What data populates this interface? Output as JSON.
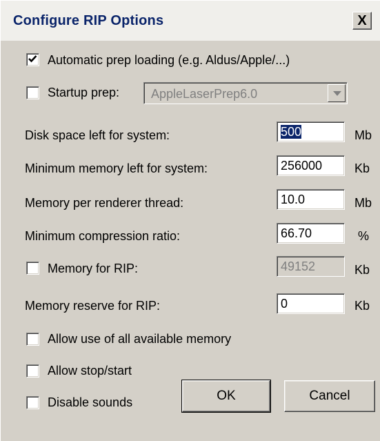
{
  "window": {
    "title": "Configure RIP Options",
    "close_label": "X"
  },
  "options": {
    "auto_prep": {
      "label": "Automatic prep loading (e.g. Aldus/Apple/...)",
      "checked": true
    },
    "startup_prep": {
      "label": "Startup prep:",
      "checked": false,
      "value": "AppleLaserPrep6.0",
      "enabled": false
    }
  },
  "fields": {
    "disk_space": {
      "label": "Disk space left for system:",
      "value": "500",
      "unit": "Mb"
    },
    "min_memory": {
      "label": "Minimum memory left for system:",
      "value": "256000",
      "unit": "Kb"
    },
    "memory_per_thread": {
      "label": "Memory per renderer thread:",
      "value": "10.0",
      "unit": "Mb"
    },
    "min_compression": {
      "label": "Minimum compression ratio:",
      "value": "66.70",
      "unit": "%"
    },
    "memory_for_rip": {
      "label": "Memory for RIP:",
      "value": "49152",
      "unit": "Kb",
      "checked": false,
      "enabled": false
    },
    "memory_reserve": {
      "label": "Memory reserve for RIP:",
      "value": "0",
      "unit": "Kb"
    }
  },
  "toggles": {
    "allow_all_memory": {
      "label": "Allow use of all available memory",
      "checked": false
    },
    "allow_stop_start": {
      "label": "Allow stop/start",
      "checked": false
    },
    "disable_sounds": {
      "label": "Disable sounds",
      "checked": false
    }
  },
  "buttons": {
    "ok": "OK",
    "cancel": "Cancel"
  }
}
